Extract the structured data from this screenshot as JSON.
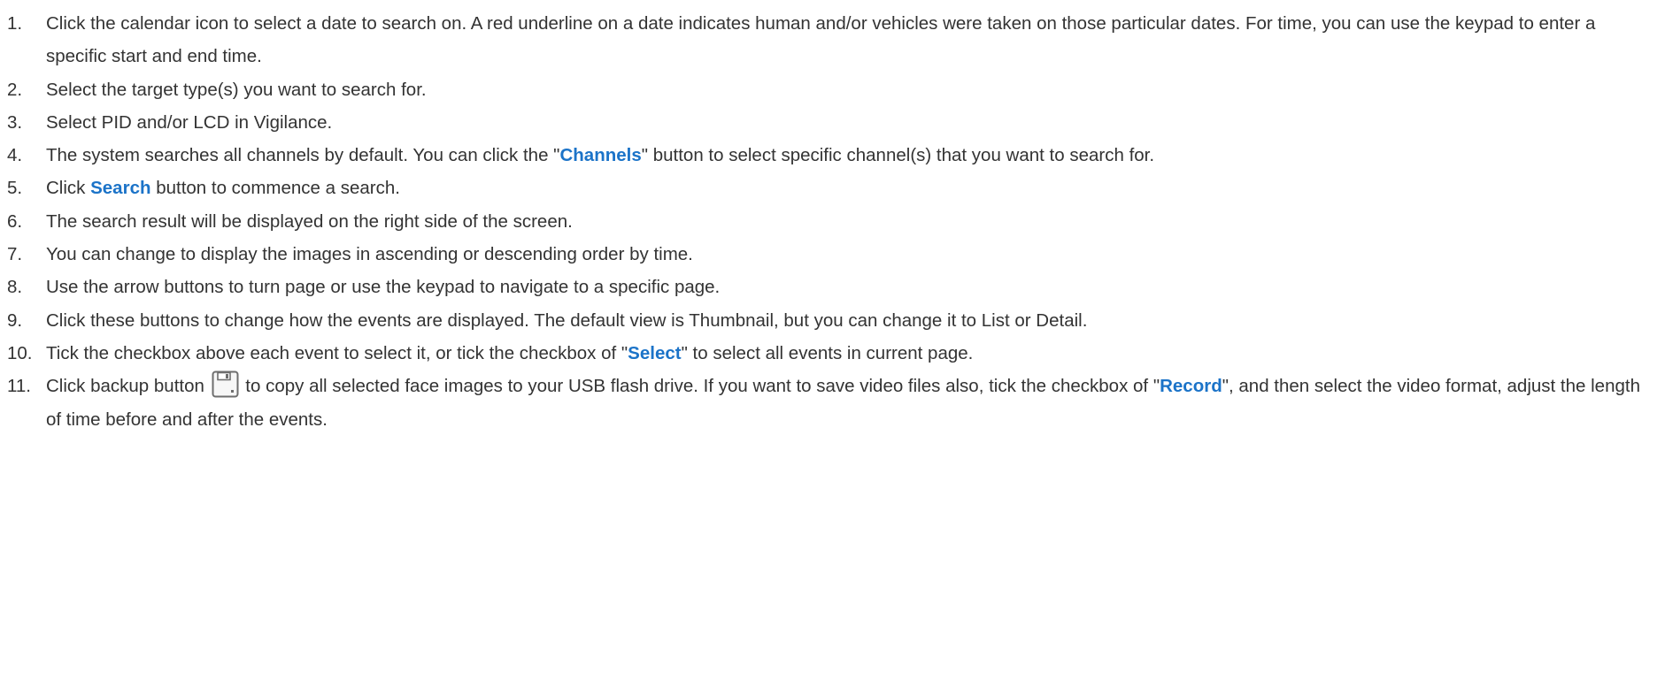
{
  "steps": [
    {
      "number": "1.",
      "text": "Click the calendar icon to select a date to search on. A red underline on a date indicates human and/or vehicles were taken on those particular dates. For time, you can use the keypad to enter a specific start and end time."
    },
    {
      "number": "2.",
      "text": "Select the target type(s) you want to search for."
    },
    {
      "number": "3.",
      "text": "Select PID and/or LCD in Vigilance."
    },
    {
      "number": "4.",
      "before": "The system searches all channels by default. You can click the \"",
      "highlight": "Channels",
      "after": "\" button to select specific channel(s) that you want to search for."
    },
    {
      "number": "5.",
      "before": "Click ",
      "highlight": "Search",
      "after": " button to commence a search."
    },
    {
      "number": "6.",
      "text": "The search result will be displayed on the right side of the screen."
    },
    {
      "number": "7.",
      "text": "You can change to display the images in ascending or descending order by time."
    },
    {
      "number": "8.",
      "text": "Use the arrow buttons to turn page or use the keypad to navigate to a specific page."
    },
    {
      "number": "9.",
      "text": "Click these buttons to change how the events are displayed. The default view is Thumbnail, but you can change it to List or Detail."
    },
    {
      "number": "10.",
      "before": "Tick the checkbox above each event to select it, or tick the checkbox of \"",
      "highlight": "Select",
      "after": "\" to select all events in current page."
    },
    {
      "number": "11.",
      "before": "Click backup button ",
      "icon": "floppy-disk-icon",
      "middle": " to copy all selected face images to your USB flash drive. If you want to save video files also, tick the checkbox of \"",
      "highlight": "Record",
      "after": "\", and then select the video format, adjust the length of time before and after the events."
    }
  ],
  "colors": {
    "text": "#333333",
    "highlight": "#1b73c8",
    "background": "#ffffff"
  }
}
